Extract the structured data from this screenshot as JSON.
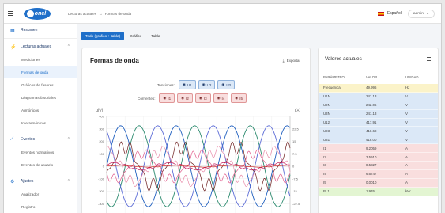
{
  "header": {
    "logo_text": "onel",
    "breadcrumb": [
      "Lecturas actuales",
      "→",
      "Formas de onda"
    ],
    "language": "Español",
    "user": "admin"
  },
  "sidebar": {
    "items": [
      {
        "type": "head",
        "label": "Resumen",
        "icon": "grid-icon"
      },
      {
        "type": "head",
        "label": "Lecturas actuales",
        "icon": "bolt-icon",
        "chevron": "^"
      },
      {
        "type": "sub",
        "label": "Mediciones"
      },
      {
        "type": "sub",
        "label": "Formas de onda",
        "active": true
      },
      {
        "type": "sub",
        "label": "Gráficos de fasores"
      },
      {
        "type": "sub",
        "label": "Diagramas fasoriales"
      },
      {
        "type": "sub",
        "label": "Armónicos"
      },
      {
        "type": "sub",
        "label": "Interarmónicos"
      },
      {
        "type": "head",
        "label": "Eventos",
        "icon": "chart-line-icon",
        "chevron": "^"
      },
      {
        "type": "sub",
        "label": "Eventos normativos"
      },
      {
        "type": "sub",
        "label": "Eventos de usuario"
      },
      {
        "type": "head",
        "label": "Ajustes",
        "icon": "gear-icon",
        "chevron": "^"
      },
      {
        "type": "sub",
        "label": "Analizador"
      },
      {
        "type": "sub",
        "label": "Registro"
      }
    ]
  },
  "tabs": [
    {
      "label": "Todo (gráfico + tabla)",
      "active": true
    },
    {
      "label": "Gráfico"
    },
    {
      "label": "Tabla"
    }
  ],
  "waveform": {
    "title": "Formas de onda",
    "export_label": "Exportar",
    "voltages_label": "Tensiones:",
    "voltages": [
      "U1",
      "U2",
      "U3"
    ],
    "currents_label": "Corrientes:",
    "currents": [
      "I1",
      "I2",
      "I3",
      "I4",
      "I5"
    ]
  },
  "chart_data": {
    "type": "line",
    "ylabel_left": "U[V]",
    "ylabel_right": "I[A]",
    "y_left_ticks": [
      "400",
      "300",
      "200",
      "100",
      "0",
      "-100",
      "-200",
      "-300",
      "-400"
    ],
    "y_right_ticks": [
      "22.5",
      "15",
      "7.5",
      "0",
      "-7.5",
      "-15",
      "-22.5"
    ],
    "ylim_left": [
      -400,
      400
    ],
    "ylim_right": [
      -30,
      30
    ],
    "grid": true,
    "series": [
      {
        "name": "U1",
        "axis": "left",
        "amplitude": 325,
        "phase": 0,
        "color": "#1f5fbf"
      },
      {
        "name": "U2",
        "axis": "left",
        "amplitude": 325,
        "phase": -120,
        "color": "#2b8a6e"
      },
      {
        "name": "U3",
        "axis": "left",
        "amplitude": 325,
        "phase": 120,
        "color": "#5b6bd6"
      },
      {
        "name": "I1",
        "axis": "right",
        "amplitude": 12,
        "phase": -30,
        "color": "#6b1a1a"
      },
      {
        "name": "I2",
        "axis": "right",
        "amplitude": 8,
        "phase": -150,
        "color": "#e05a8a"
      },
      {
        "name": "I3",
        "axis": "right",
        "amplitude": 10,
        "phase": 90,
        "color": "#e88aa8"
      },
      {
        "name": "I4",
        "axis": "right",
        "amplitude": 2,
        "phase": 45,
        "color": "#c2185b"
      },
      {
        "name": "I5",
        "axis": "right",
        "amplitude": 0.5,
        "phase": 0,
        "color": "#d32f2f"
      }
    ],
    "periods": 3.3
  },
  "current_values": {
    "title": "Valores actuales",
    "columns": [
      "PARÁMETRO",
      "VALOR",
      "UNIDAD"
    ],
    "rows": [
      {
        "param": "Frecuencia",
        "value": "49.996",
        "unit": "Hz",
        "color": "#fbf3c9"
      },
      {
        "param": "U1N",
        "value": "241.13",
        "unit": "V",
        "color": "#dbe8f7"
      },
      {
        "param": "U2N",
        "value": "242.06",
        "unit": "V",
        "color": "#dbe8f7"
      },
      {
        "param": "U3N",
        "value": "241.13",
        "unit": "V",
        "color": "#dbe8f7"
      },
      {
        "param": "U12",
        "value": "417.91",
        "unit": "V",
        "color": "#dbe8f7"
      },
      {
        "param": "U23",
        "value": "418.68",
        "unit": "V",
        "color": "#dbe8f7"
      },
      {
        "param": "U31",
        "value": "418.00",
        "unit": "V",
        "color": "#dbe8f7"
      },
      {
        "param": "I1",
        "value": "9.2059",
        "unit": "A",
        "color": "#f9dede"
      },
      {
        "param": "I2",
        "value": "3.5910",
        "unit": "A",
        "color": "#f9dede"
      },
      {
        "param": "I3",
        "value": "8.5827",
        "unit": "A",
        "color": "#f9dede"
      },
      {
        "param": "I4",
        "value": "6.6747",
        "unit": "A",
        "color": "#f9dede"
      },
      {
        "param": "I5",
        "value": "0.0010",
        "unit": "A",
        "color": "#f9dede"
      },
      {
        "param": "PL1",
        "value": "1.976",
        "unit": "kW",
        "color": "#e3f5d2"
      }
    ]
  }
}
